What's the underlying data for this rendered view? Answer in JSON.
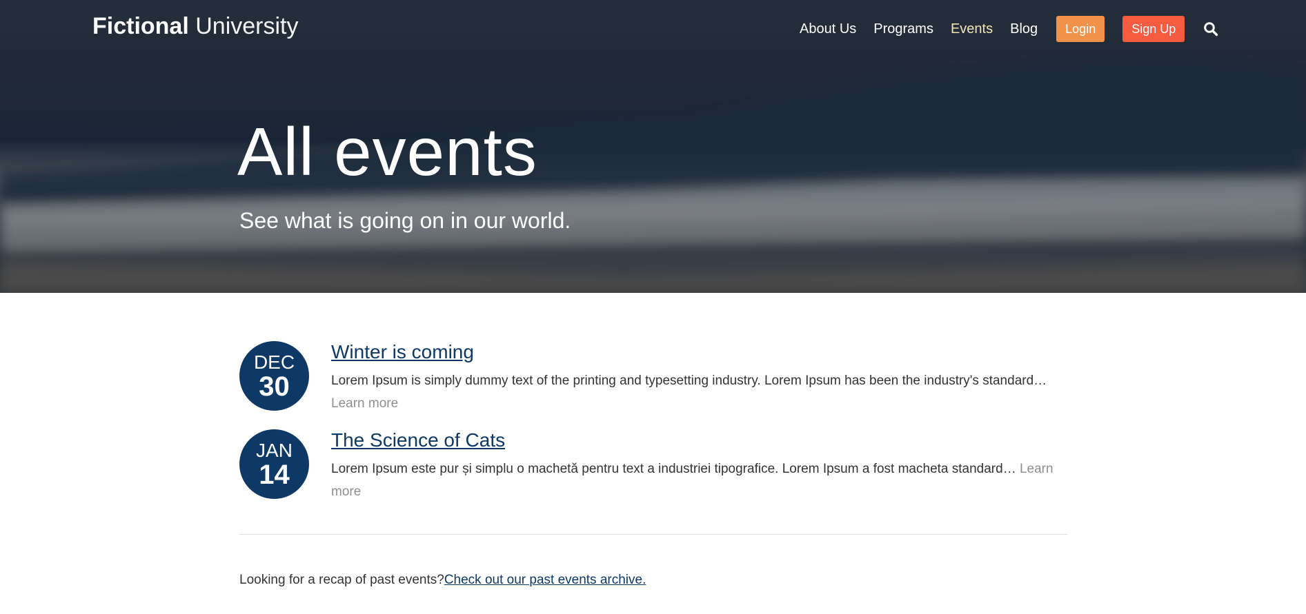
{
  "header": {
    "logo_strong": "Fictional",
    "logo_light": "University",
    "nav": {
      "about": "About Us",
      "programs": "Programs",
      "events": "Events",
      "blog": "Blog"
    },
    "login_label": "Login",
    "signup_label": "Sign Up",
    "search_icon": "search-icon"
  },
  "hero": {
    "title": "All events",
    "subtitle": "See what is going on in our world."
  },
  "events": [
    {
      "month": "DEC",
      "day": "30",
      "title": "Winter is coming",
      "excerpt": "Lorem Ipsum is simply dummy text of the printing and typesetting industry. Lorem Ipsum has been the industry's standard… ",
      "learn_more": "Learn more"
    },
    {
      "month": "JAN",
      "day": "14",
      "title": "The Science of Cats",
      "excerpt": "Lorem Ipsum este pur și simplu o machetă pentru text a industriei tipografice. Lorem Ipsum a fost macheta standard… ",
      "learn_more": "Learn more"
    }
  ],
  "archive": {
    "text": "Looking for a recap of past events?",
    "link": "Check out our past events archive."
  },
  "colors": {
    "brand_blue": "#0e3966",
    "login_orange": "#f0924a",
    "signup_red": "#f55b3f",
    "active_nav": "#f4e6b4"
  }
}
